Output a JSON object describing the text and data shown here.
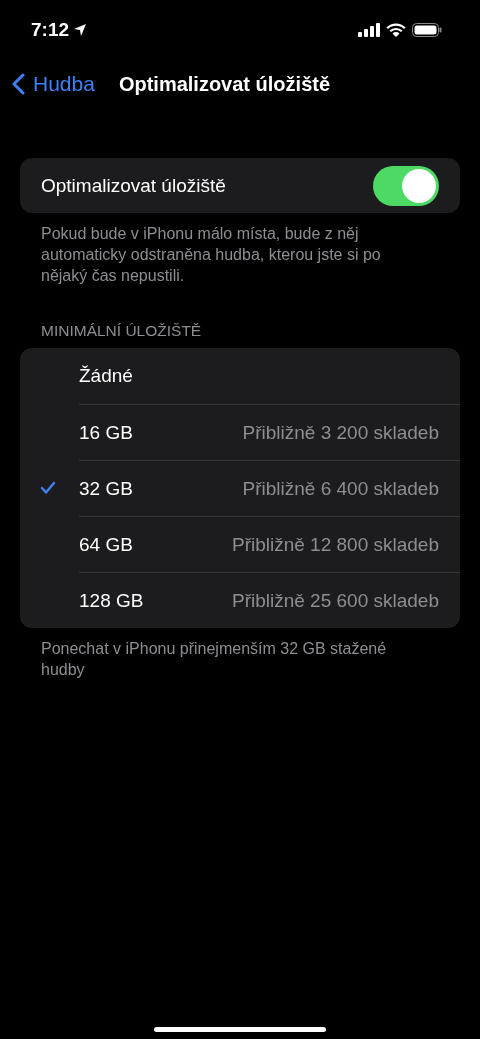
{
  "status_bar": {
    "time": "7:12"
  },
  "nav": {
    "back": "Hudba",
    "title": "Optimalizovat úložiště"
  },
  "toggle": {
    "label": "Optimalizovat úložiště",
    "on": true
  },
  "toggle_footer": "Pokud bude v iPhonu málo místa, bude z něj automaticky odstraněna hudba, kterou jste si po nějaký čas nepustili.",
  "section_header": "MINIMÁLNÍ ÚLOŽIŠTĚ",
  "options": [
    {
      "label": "Žádné",
      "selected": false
    },
    {
      "label": "16 GB",
      "detail": "Přibližně 3 200 skladeb",
      "selected": false
    },
    {
      "label": "32 GB",
      "detail": "Přibližně 6 400 skladeb",
      "selected": true
    },
    {
      "label": "64 GB",
      "detail": "Přibližně 12 800 skladeb",
      "selected": false
    },
    {
      "label": "128 GB",
      "detail": "Přibližně 25 600 skladeb",
      "selected": false
    }
  ],
  "options_footer": "Ponechat v iPhonu přinejmenším 32 GB stažené hudby"
}
